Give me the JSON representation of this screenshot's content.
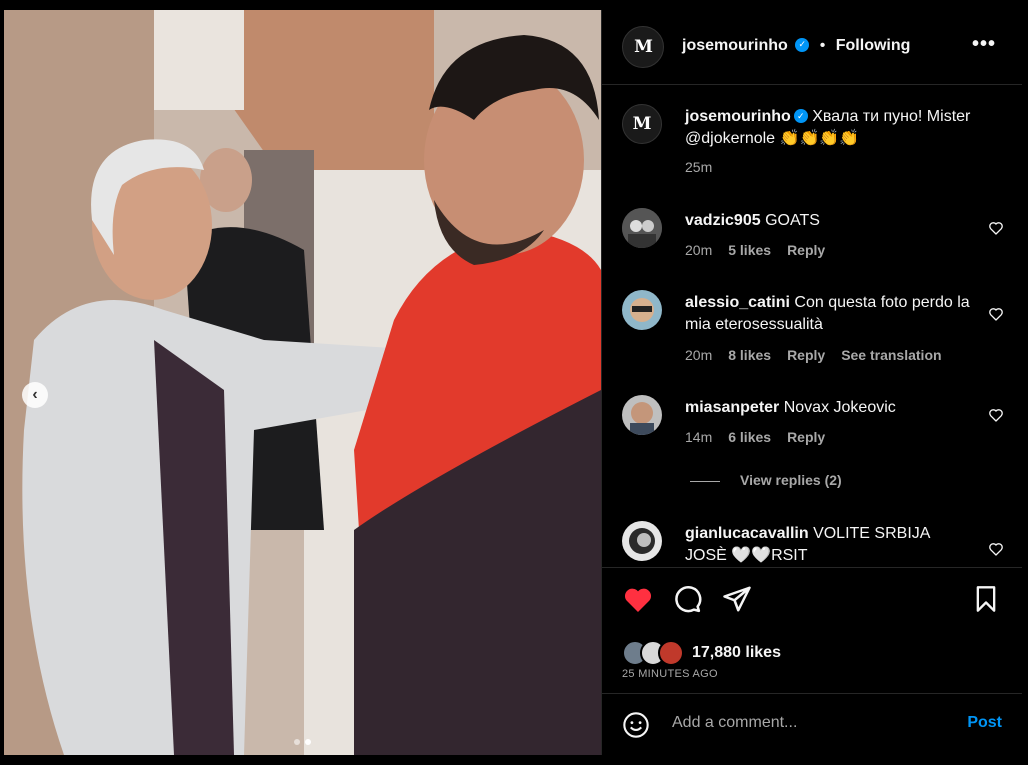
{
  "post": {
    "username": "josemourinho",
    "follow_state": "Following",
    "separator": "•",
    "more": "•••",
    "avatar_letter": "M"
  },
  "caption": {
    "username": "josemourinho",
    "text": "Хвала ти пуно! Mister @djokernole 👏👏👏👏",
    "time": "25m"
  },
  "comments": [
    {
      "username": "vadzic905",
      "text": "GOATS",
      "time": "20m",
      "likes": "5 likes",
      "reply": "Reply",
      "extra": ""
    },
    {
      "username": "alessio_catini",
      "text": "Con questa foto perdo la mia eterosessualità",
      "time": "20m",
      "likes": "8 likes",
      "reply": "Reply",
      "extra": "See translation"
    },
    {
      "username": "miasanpeter",
      "text": "Novax Jokeovic",
      "time": "14m",
      "likes": "6 likes",
      "reply": "Reply",
      "extra": ""
    },
    {
      "username": "gianlucacavallin",
      "text": "VOLITE SRBIJA JOSÈ 🤍🤍RSIT",
      "time": "",
      "likes": "",
      "reply": "",
      "extra": ""
    }
  ],
  "view_replies": "View replies (2)",
  "likes": {
    "count_text": "17,880 likes",
    "ago": "25 MINUTES AGO"
  },
  "comment_box": {
    "placeholder": "Add a comment...",
    "post_label": "Post"
  },
  "carousel": {
    "prev": "‹",
    "current": 2,
    "total": 2
  },
  "colors": {
    "like_red": "#ff3040",
    "link_blue": "#0095f6",
    "verified": "#0095f6"
  },
  "icons": [
    "heart-icon",
    "comment-icon",
    "share-icon",
    "bookmark-icon",
    "emoji-icon",
    "verified-icon",
    "more-icon",
    "chevron-left-icon"
  ]
}
